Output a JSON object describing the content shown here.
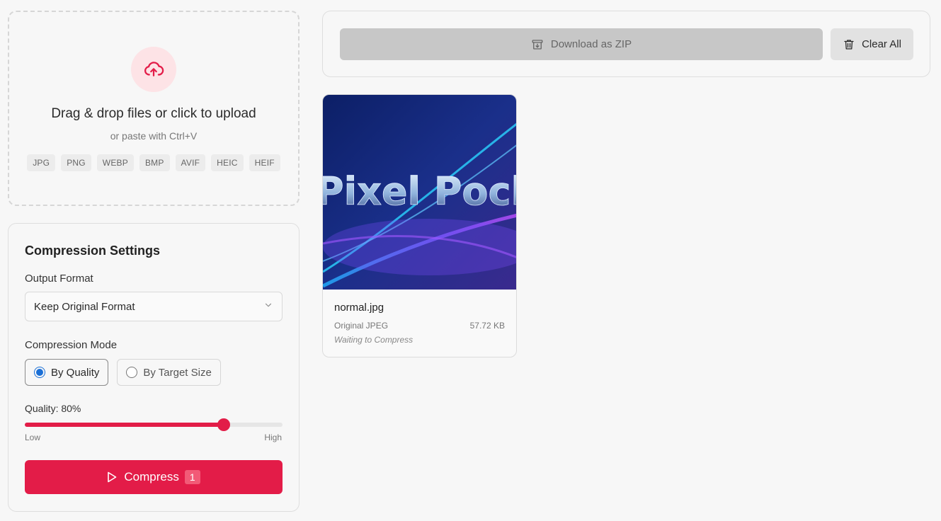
{
  "upload": {
    "title": "Drag & drop files or click to upload",
    "subtitle": "or paste with Ctrl+V",
    "formats": [
      "JPG",
      "PNG",
      "WEBP",
      "BMP",
      "AVIF",
      "HEIC",
      "HEIF"
    ]
  },
  "settings": {
    "title": "Compression Settings",
    "output_format_label": "Output Format",
    "output_format_value": "Keep Original Format",
    "mode_label": "Compression Mode",
    "modes": [
      {
        "label": "By Quality",
        "selected": true
      },
      {
        "label": "By Target Size",
        "selected": false
      }
    ],
    "quality_label": "Quality: 80%",
    "quality_value": 0.8,
    "slider_low": "Low",
    "slider_high": "High",
    "compress_label": "Compress",
    "compress_count": "1"
  },
  "toolbar": {
    "download_label": "Download as ZIP",
    "clear_label": "Clear All"
  },
  "files": [
    {
      "name": "normal.jpg",
      "thumbnail_text": "Pixel Pocket",
      "original_format": "Original JPEG",
      "size": "57.72 KB",
      "status": "Waiting to Compress"
    }
  ],
  "colors": {
    "accent": "#e31c48",
    "radio": "#1a6fd6"
  }
}
